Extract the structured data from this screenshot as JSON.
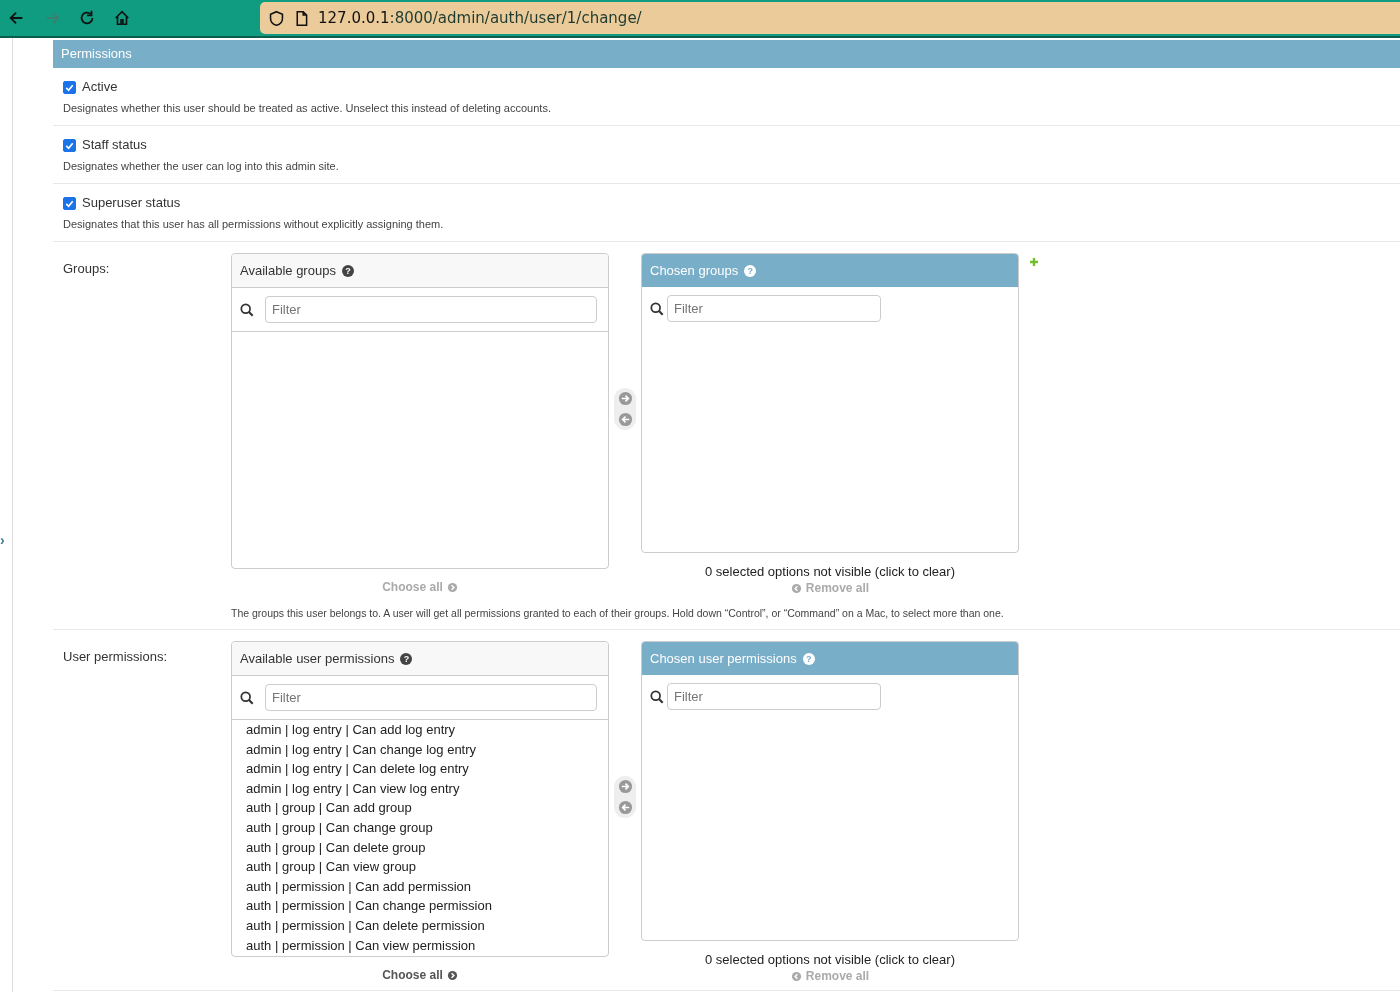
{
  "browser": {
    "url_host": "127.0.0.1",
    "url_rest": ":8000/admin/auth/user/1/change/"
  },
  "sidebar_toggle": "›",
  "fieldset": {
    "title": "Permissions"
  },
  "checkboxes": [
    {
      "label": "Active",
      "checked": true,
      "help": "Designates whether this user should be treated as active. Unselect this instead of deleting accounts."
    },
    {
      "label": "Staff status",
      "checked": true,
      "help": "Designates whether the user can log into this admin site."
    },
    {
      "label": "Superuser status",
      "checked": true,
      "help": "Designates that this user has all permissions without explicitly assigning them."
    }
  ],
  "selectors": [
    {
      "label": "Groups:",
      "available_title": "Available groups",
      "available_help_icon": "?",
      "available_placeholder": "Filter",
      "chosen_title": "Chosen groups",
      "chosen_help_icon": "?",
      "chosen_placeholder": "Filter",
      "show_add": true,
      "choose_all": {
        "label": "Choose all",
        "disabled": true
      },
      "not_visible": "0 selected options not visible (click to clear)",
      "remove_all": {
        "label": "Remove all",
        "disabled": true
      },
      "help": "The groups this user belongs to. A user will get all permissions granted to each of their groups. Hold down “Control”, or “Command” on a Mac, to select more than one."
    },
    {
      "label": "User permissions:",
      "available_title": "Available user permissions",
      "available_help_icon": "?",
      "available_placeholder": "Filter",
      "available_options": [
        "admin | log entry | Can add log entry",
        "admin | log entry | Can change log entry",
        "admin | log entry | Can delete log entry",
        "admin | log entry | Can view log entry",
        "auth | group | Can add group",
        "auth | group | Can change group",
        "auth | group | Can delete group",
        "auth | group | Can view group",
        "auth | permission | Can add permission",
        "auth | permission | Can change permission",
        "auth | permission | Can delete permission",
        "auth | permission | Can view permission"
      ],
      "chosen_title": "Chosen user permissions",
      "chosen_help_icon": "?",
      "chosen_placeholder": "Filter",
      "show_add": false,
      "choose_all": {
        "label": "Choose all",
        "disabled": false
      },
      "not_visible": "0 selected options not visible (click to clear)",
      "remove_all": {
        "label": "Remove all",
        "disabled": true
      }
    }
  ]
}
